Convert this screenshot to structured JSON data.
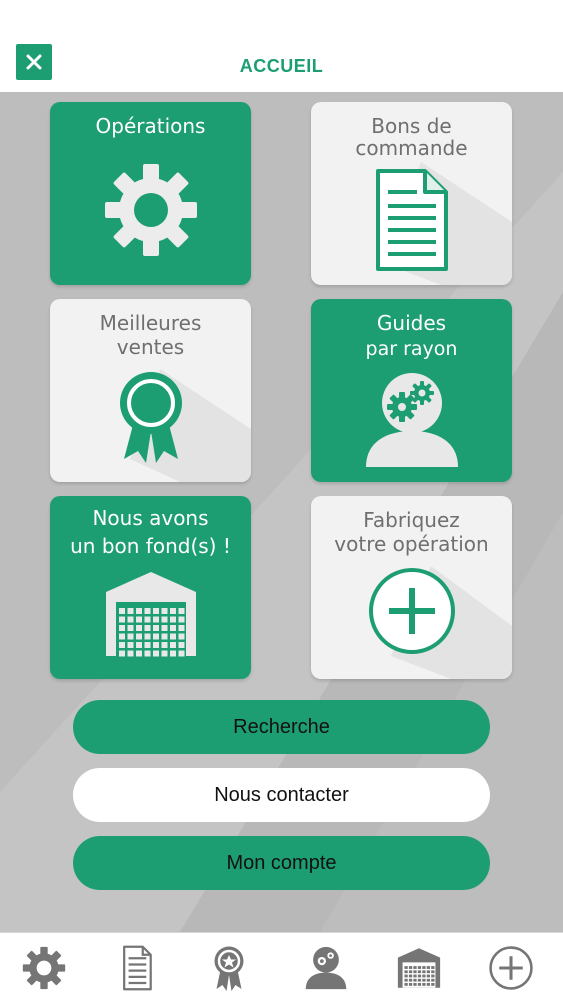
{
  "header": {
    "title": "ACCUEIL",
    "close_icon": "close-icon"
  },
  "tiles": [
    {
      "label_line1": "Opérations",
      "label_line2": "",
      "icon": "gear-icon",
      "style": "green"
    },
    {
      "label_line1": "Bons de",
      "label_line2": "commande",
      "icon": "document-icon",
      "style": "white"
    },
    {
      "label_line1": "Meilleures",
      "label_line2": "ventes",
      "icon": "award-ribbon-icon",
      "style": "white"
    },
    {
      "label_line1": "Guides",
      "label_line2": "par rayon",
      "icon": "person-gears-icon",
      "style": "green"
    },
    {
      "label_line1": "Nous avons",
      "label_line2": "un bon fond(s) !",
      "icon": "warehouse-icon",
      "style": "green"
    },
    {
      "label_line1": "Fabriquez",
      "label_line2": "votre opération",
      "icon": "plus-circle-icon",
      "style": "white"
    }
  ],
  "buttons": {
    "search": "Recherche",
    "contact": "Nous contacter",
    "account": "Mon compte"
  },
  "tabbar": {
    "items": [
      "gear-icon",
      "document-icon",
      "award-ribbon-icon",
      "person-gears-icon",
      "warehouse-icon",
      "plus-circle-icon"
    ]
  },
  "colors": {
    "accent": "#1d9e72",
    "background": "#bcbcbc",
    "tile_white": "#f2f2f2",
    "tab_icon": "#757575"
  }
}
